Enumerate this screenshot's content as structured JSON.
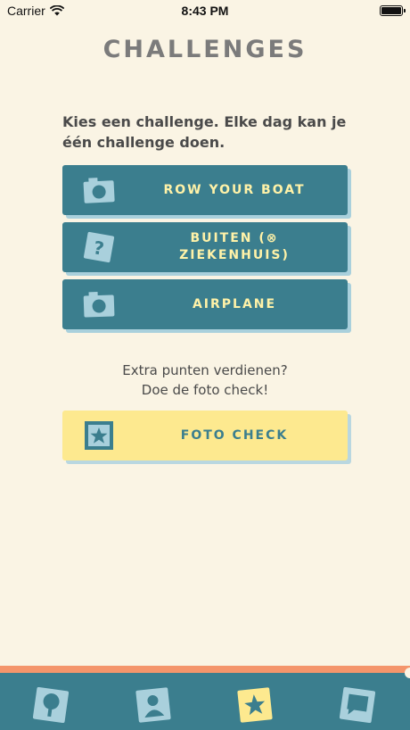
{
  "status_bar": {
    "carrier": "Carrier",
    "time": "8:43 PM"
  },
  "header": {
    "title": "CHALLENGES"
  },
  "intro": "Kies een challenge. Elke dag kan je één challenge doen.",
  "challenges": [
    {
      "label": "ROW YOUR BOAT",
      "icon": "camera-icon"
    },
    {
      "label": "BUITEN (⊗\nZIEKENHUIS)",
      "icon": "question-icon"
    },
    {
      "label": "AIRPLANE",
      "icon": "camera-icon"
    }
  ],
  "extra": {
    "line1": "Extra punten verdienen?",
    "line2": "Doe de foto check!"
  },
  "foto_check": {
    "label": "FOTO CHECK",
    "icon": "star-photo-icon"
  },
  "tab_bar": {
    "tabs": [
      {
        "icon": "tree-icon",
        "active": false
      },
      {
        "icon": "profile-icon",
        "active": false
      },
      {
        "icon": "star-icon",
        "active": true
      },
      {
        "icon": "chat-icon",
        "active": false
      }
    ]
  },
  "colors": {
    "background": "#faf4e4",
    "primary": "#3b7e8e",
    "accent_yellow": "#fde98f",
    "label_yellow": "#fff2a8",
    "tab_border": "#f4956b",
    "icon_light_blue": "#a9d0dc"
  }
}
